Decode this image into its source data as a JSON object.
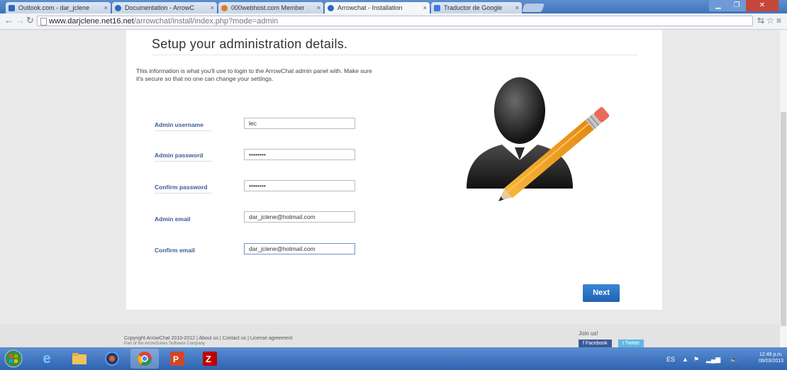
{
  "browser": {
    "tabs": [
      {
        "title": "Outlook.com - dar_jclene",
        "favicon_color": "#2a6ac0",
        "active": false
      },
      {
        "title": "Documentation - ArrowC",
        "favicon_color": "#2a6ac0",
        "active": false
      },
      {
        "title": "000webhost.com Member",
        "favicon_color": "#e07b20",
        "active": false
      },
      {
        "title": "Arrowchat - Installation",
        "favicon_color": "#2a6ac0",
        "active": true
      },
      {
        "title": "Traductor de Google",
        "favicon_color": "#3b7be0",
        "active": false
      }
    ],
    "url_host": "www.darjclene.net16.net",
    "url_path": "/arrowchat/install/index.php?mode=admin"
  },
  "page": {
    "heading": "Setup your administration details.",
    "intro": "This information is what you'll use to login to the ArrowChat admin panel with. Make sure it's secure so that no one can change your settings.",
    "fields": [
      {
        "label": "Admin username",
        "value": "lec"
      },
      {
        "label": "Admin password",
        "value": "••••••••"
      },
      {
        "label": "Confirm password",
        "value": "••••••••"
      },
      {
        "label": "Admin email",
        "value": "dar_jclene@hotmail.com"
      },
      {
        "label": "Confirm email",
        "value": "dar_jclene@hotmail.com"
      }
    ],
    "next_label": "Next"
  },
  "footer": {
    "copyright": "Copyright ArrowChat 2010-2012 | About us | Contact us | License agreement",
    "sub": "Part of the ArrowSuites Software Company",
    "join": "Join us!",
    "facebook": "Facebook",
    "twitter": "Twitter"
  },
  "taskbar": {
    "tray_lang": "ES",
    "time": "12:49 p.m.",
    "date": "06/03/2013"
  }
}
